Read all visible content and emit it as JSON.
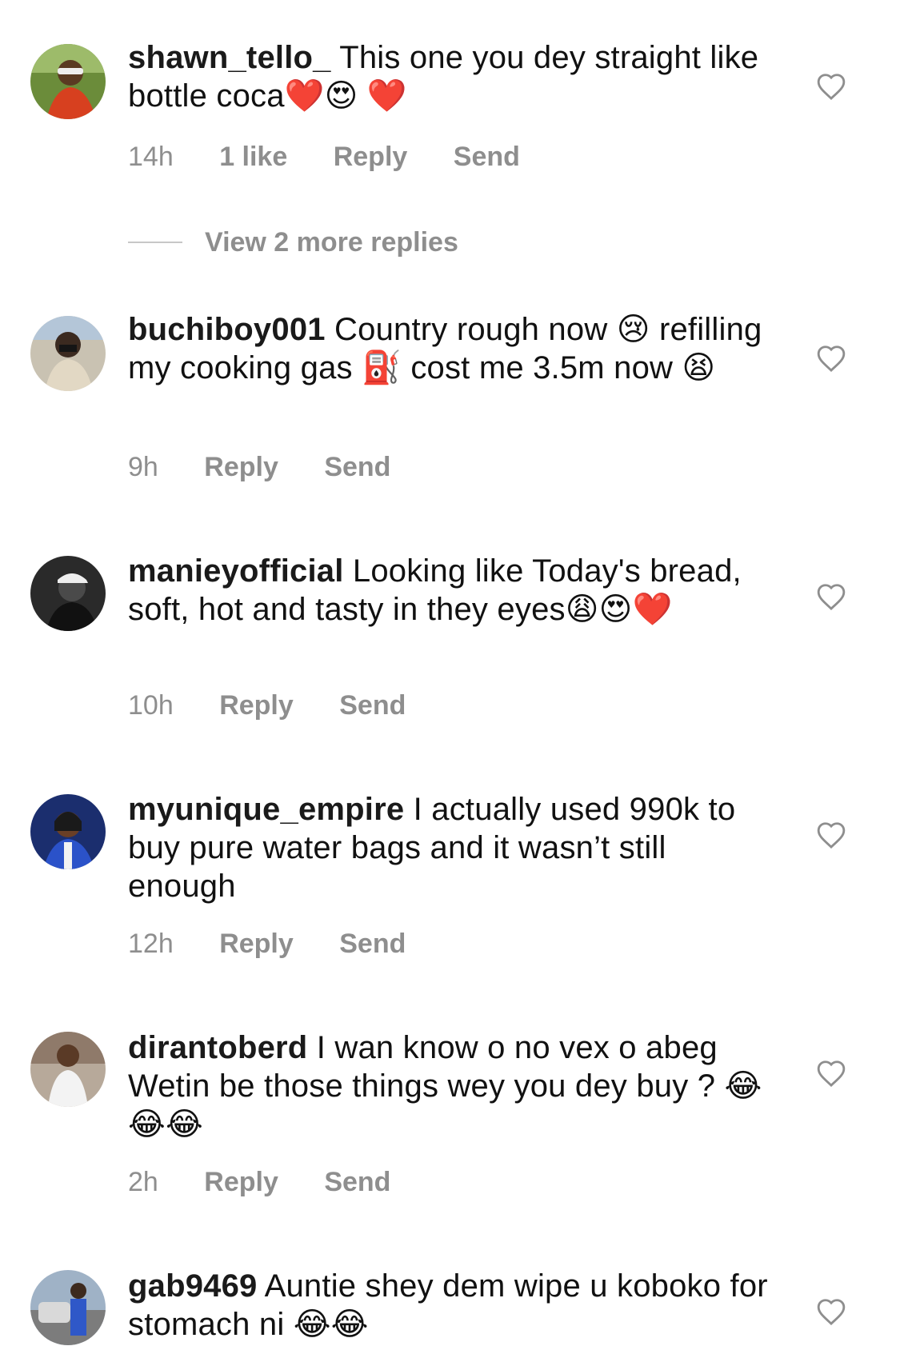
{
  "comments": [
    {
      "username": "shawn_tello_",
      "text": "This one you dey straight like bottle coca❤️😍 ❤️",
      "time": "14h",
      "likes": "1 like",
      "reply": "Reply",
      "send": "Send"
    },
    {
      "username": "buchiboy001",
      "text": "Country rough now 😢 refilling my cooking gas ⛽ cost me 3.5m now 😫",
      "time": "9h",
      "reply": "Reply",
      "send": "Send"
    },
    {
      "username": "manieyofficial",
      "text": "Looking like Today's bread, soft, hot and tasty in they eyes😩😍❤️",
      "time": "10h",
      "reply": "Reply",
      "send": "Send"
    },
    {
      "username": "myunique_empire",
      "text": "I actually used 990k to buy pure water bags and it wasn’t still enough",
      "time": "12h",
      "reply": "Reply",
      "send": "Send"
    },
    {
      "username": "dirantoberd",
      "text": "I wan know o no vex o abeg Wetin be those things wey you dey buy ? 😂😂😂",
      "time": "2h",
      "reply": "Reply",
      "send": "Send"
    },
    {
      "username": "gab9469",
      "text": "Auntie shey dem wipe u koboko for stomach ni 😂😂",
      "time": "",
      "reply": "",
      "send": ""
    }
  ],
  "view_replies": "View 2 more replies",
  "icons": {
    "like": "heart-outline-icon"
  },
  "colors": {
    "meta_text": "#8e8e8e",
    "divider": "#c7c7c7"
  }
}
